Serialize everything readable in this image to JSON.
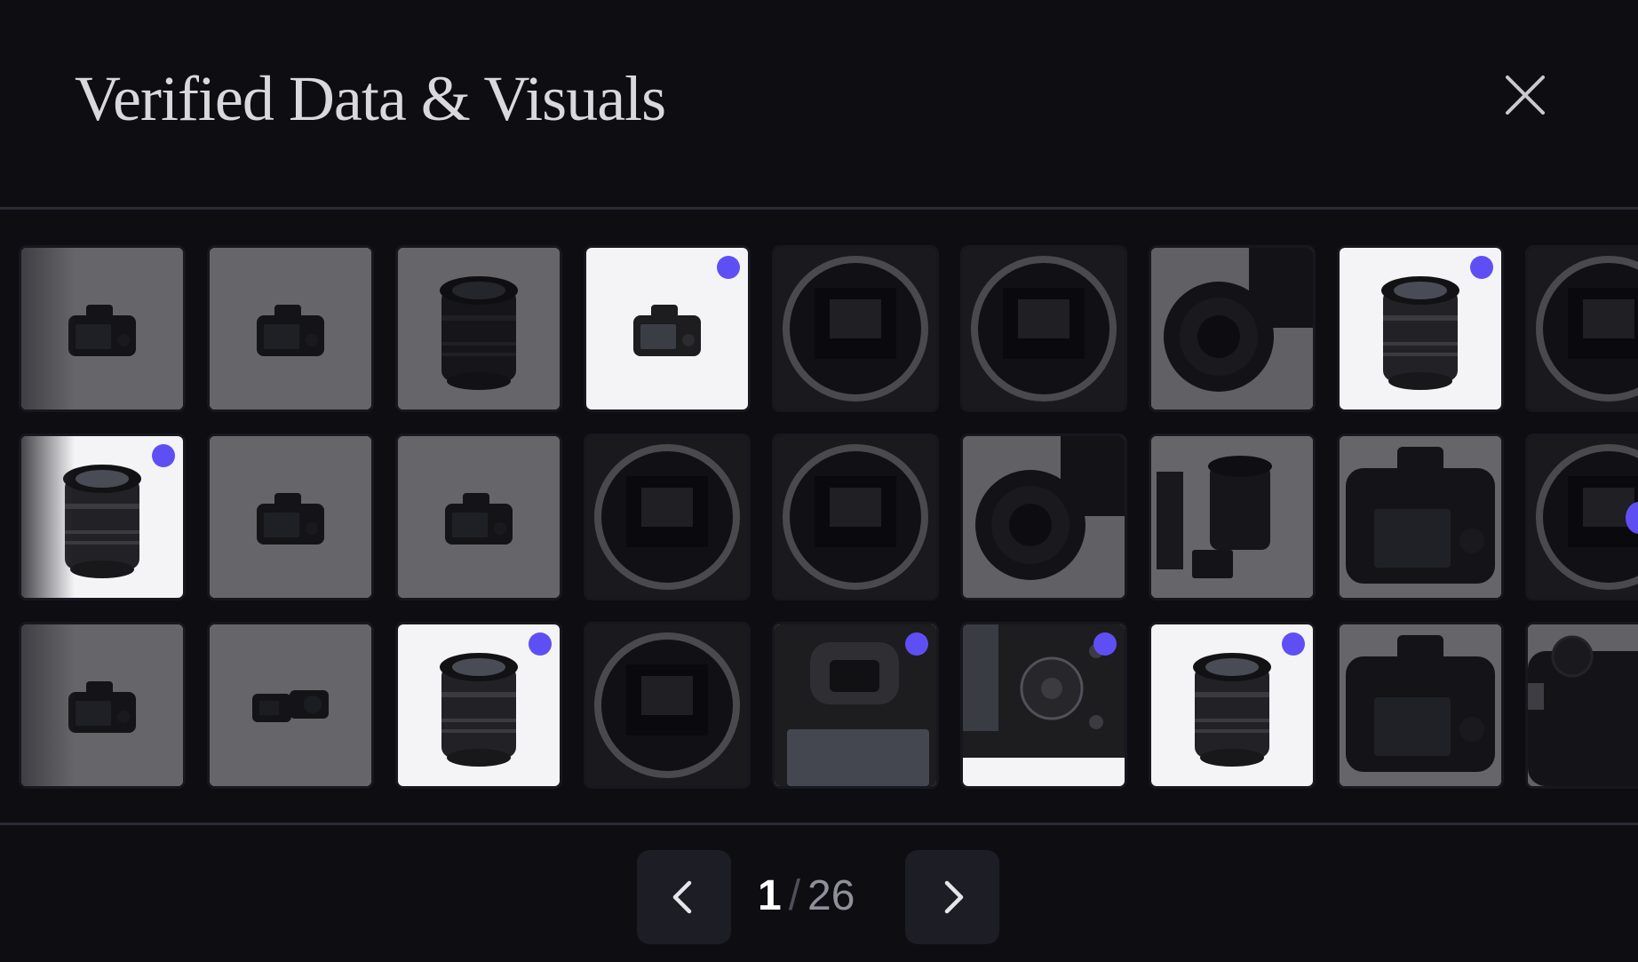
{
  "header": {
    "title": "Verified Data & Visuals",
    "close_icon": "close-icon"
  },
  "grid": {
    "accent_color": "#5e4ff5",
    "tiles": [
      {
        "subject": "camera-small",
        "verified": false,
        "highlighted": false
      },
      {
        "subject": "camera-small",
        "verified": false,
        "highlighted": false
      },
      {
        "subject": "lens",
        "verified": false,
        "highlighted": false
      },
      {
        "subject": "camera-small",
        "verified": true,
        "highlighted": true
      },
      {
        "subject": "mount",
        "verified": false,
        "highlighted": false
      },
      {
        "subject": "mount",
        "verified": false,
        "highlighted": false
      },
      {
        "subject": "camera-closeup",
        "verified": false,
        "highlighted": false
      },
      {
        "subject": "lens",
        "verified": true,
        "highlighted": true
      },
      {
        "subject": "mount",
        "verified": false,
        "highlighted": false
      },
      {
        "subject": "lens",
        "verified": true,
        "highlighted": true
      },
      {
        "subject": "camera-small",
        "verified": false,
        "highlighted": false
      },
      {
        "subject": "camera-small",
        "verified": false,
        "highlighted": false
      },
      {
        "subject": "mount",
        "verified": false,
        "highlighted": false
      },
      {
        "subject": "mount",
        "verified": false,
        "highlighted": false
      },
      {
        "subject": "camera-closeup",
        "verified": false,
        "highlighted": false
      },
      {
        "subject": "lens-with-battery",
        "verified": false,
        "highlighted": false
      },
      {
        "subject": "camera-back",
        "verified": false,
        "highlighted": false
      },
      {
        "subject": "mount",
        "verified": false,
        "highlighted": false
      },
      {
        "subject": "camera-small",
        "verified": false,
        "highlighted": false
      },
      {
        "subject": "two-cameras",
        "verified": false,
        "highlighted": false
      },
      {
        "subject": "lens",
        "verified": true,
        "highlighted": true
      },
      {
        "subject": "mount",
        "verified": false,
        "highlighted": false
      },
      {
        "subject": "viewfinder",
        "verified": true,
        "highlighted": true
      },
      {
        "subject": "buttons",
        "verified": true,
        "highlighted": true
      },
      {
        "subject": "lens",
        "verified": true,
        "highlighted": true
      },
      {
        "subject": "camera-back",
        "verified": false,
        "highlighted": false
      },
      {
        "subject": "camera-top",
        "verified": false,
        "highlighted": false
      }
    ]
  },
  "pagination": {
    "current": "1",
    "separator": "/",
    "total": "26",
    "prev_icon": "chevron-left-icon",
    "next_icon": "chevron-right-icon"
  }
}
